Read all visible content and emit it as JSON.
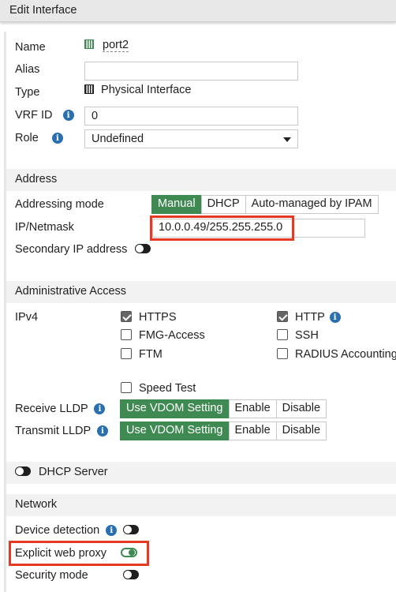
{
  "window": {
    "title": "Edit Interface"
  },
  "general": {
    "name_label": "Name",
    "name_value": "port2",
    "alias_label": "Alias",
    "alias_value": "",
    "type_label": "Type",
    "type_value": "Physical Interface",
    "vrf_label": "VRF ID",
    "vrf_value": "0",
    "role_label": "Role",
    "role_value": "Undefined"
  },
  "address": {
    "header": "Address",
    "mode_label": "Addressing mode",
    "modes": [
      "Manual",
      "DHCP",
      "Auto-managed by IPAM"
    ],
    "active_mode": "Manual",
    "ip_label": "IP/Netmask",
    "ip_value": "10.0.0.49/255.255.255.0",
    "secondary_label": "Secondary IP address",
    "secondary_enabled": false
  },
  "admin": {
    "header": "Administrative Access",
    "ipv4_label": "IPv4",
    "options": [
      {
        "label": "HTTPS",
        "checked": true
      },
      {
        "label": "HTTP",
        "checked": true
      },
      {
        "label": "FMG-Access",
        "checked": false
      },
      {
        "label": "SSH",
        "checked": false
      },
      {
        "label": "FTM",
        "checked": false
      },
      {
        "label": "RADIUS Accounting",
        "checked": false
      },
      {
        "label": "Speed Test",
        "checked": false
      }
    ],
    "receive_lldp_label": "Receive LLDP",
    "transmit_lldp_label": "Transmit LLDP",
    "lldp_options": [
      "Use VDOM Setting",
      "Enable",
      "Disable"
    ],
    "lldp_selected": "Use VDOM Setting"
  },
  "dhcp": {
    "label": "DHCP Server",
    "enabled": false
  },
  "network": {
    "header": "Network",
    "device_detection_label": "Device detection",
    "device_detection": false,
    "explicit_proxy_label": "Explicit web proxy",
    "explicit_proxy": true,
    "security_mode_label": "Security mode",
    "security_mode": false
  },
  "colors": {
    "accent_green": "#3f8a52",
    "highlight_red": "#e53922",
    "info_blue": "#2a6fb0"
  }
}
